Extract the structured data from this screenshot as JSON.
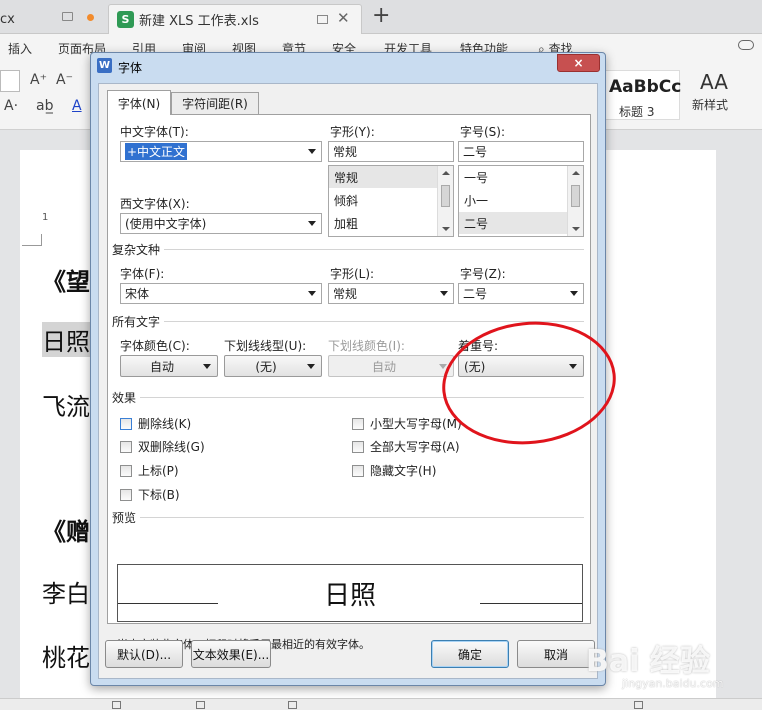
{
  "app": {
    "tabs": [
      {
        "label": "cx"
      },
      {
        "label": "新建 XLS 工作表.xls",
        "icon": "S"
      }
    ],
    "menu": [
      "插入",
      "页面布局",
      "引用",
      "审阅",
      "视图",
      "章节",
      "安全",
      "开发工具",
      "特色功能",
      "查找"
    ],
    "style_sample": "AaBbCc",
    "style_label": "标题 3",
    "new_style_label": "新样式",
    "page_number": "1",
    "doc_lines": [
      "《望",
      "日照",
      "飞流",
      "《赠",
      "李白",
      "桃花"
    ]
  },
  "dialog": {
    "title": "字体",
    "close": "×",
    "tabs": {
      "font": "字体(N)",
      "spacing": "字符间距(R)"
    },
    "chinese_font_label": "中文字体(T):",
    "chinese_font_value": "+中文正文",
    "western_font_label": "西文字体(X):",
    "western_font_value": "(使用中文字体)",
    "style_label": "字形(Y):",
    "style_value": "常规",
    "style_list": [
      "常规",
      "倾斜",
      "加粗"
    ],
    "size_label": "字号(S):",
    "size_value": "二号",
    "size_list": [
      "一号",
      "小一",
      "二号"
    ],
    "complex_title": "复杂文种",
    "complex_font_label": "字体(F):",
    "complex_font_value": "宋体",
    "complex_style_label": "字形(L):",
    "complex_style_value": "常规",
    "complex_size_label": "字号(Z):",
    "complex_size_value": "二号",
    "all_text_title": "所有文字",
    "color_label": "字体颜色(C):",
    "color_value": "自动",
    "underline_type_label": "下划线线型(U):",
    "underline_type_value": "(无)",
    "underline_color_label": "下划线颜色(I):",
    "underline_color_value": "自动",
    "emphasis_label": "着重号:",
    "emphasis_value": "(无)",
    "effects_title": "效果",
    "effects_left": [
      "删除线(K)",
      "双删除线(G)",
      "上标(P)",
      "下标(B)"
    ],
    "effects_right": [
      "小型大写字母(M)",
      "全部大写字母(A)",
      "隐藏文字(H)"
    ],
    "preview_title": "预览",
    "preview_text": "日照",
    "note": "尚未安装此字体，打印时将采用最相近的有效字体。",
    "buttons": {
      "default": "默认(D)...",
      "text_effect": "文本效果(E)...",
      "ok": "确定",
      "cancel": "取消"
    }
  },
  "watermark": {
    "brand": "Bai 经验",
    "url": "jingyan.baidu.com"
  },
  "colors": {
    "annotation": "#e0141c",
    "titlebar": "#c9dcf0",
    "close": "#c75050"
  }
}
